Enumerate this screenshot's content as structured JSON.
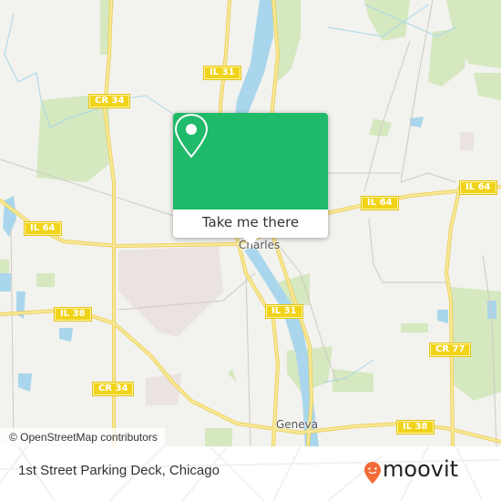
{
  "map": {
    "colors": {
      "land": "#f2f2ee",
      "water": "#a9d6ec",
      "park": "#d5e8bf",
      "road_major": "#f5e27a",
      "road_minor": "#cfcac3",
      "urban": "#ebe3e1",
      "shield": "#f1d319"
    },
    "road_shields": [
      {
        "id": "il31-north",
        "label": "IL 31"
      },
      {
        "id": "cr34-north",
        "label": "CR 34"
      },
      {
        "id": "il64-west",
        "label": "IL 64"
      },
      {
        "id": "il64-center",
        "label": "IL 64"
      },
      {
        "id": "il64-east",
        "label": "IL 64"
      },
      {
        "id": "il38-west",
        "label": "IL 38"
      },
      {
        "id": "il31-south",
        "label": "IL 31"
      },
      {
        "id": "cr77",
        "label": "CR 77"
      },
      {
        "id": "cr34-south",
        "label": "CR 34"
      },
      {
        "id": "il38-east",
        "label": "IL 38"
      }
    ],
    "cities": [
      {
        "name": "Charles"
      },
      {
        "name": "Geneva"
      }
    ],
    "attribution": "© OpenStreetMap contributors"
  },
  "popup": {
    "icon": "map-pin-icon",
    "accent_color": "#1fba6a",
    "button_label": "Take me there"
  },
  "footer": {
    "place_name": "1st Street Parking Deck, Chicago",
    "brand": "moovit",
    "brand_color": "#f26b38"
  }
}
